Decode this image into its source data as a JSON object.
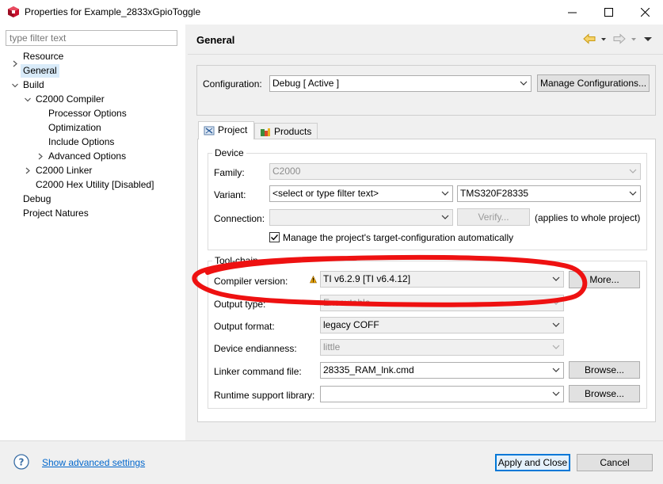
{
  "window": {
    "title": "Properties for Example_2833xGpioToggle"
  },
  "left": {
    "filter_placeholder": "type filter text",
    "tree": {
      "resource": "Resource",
      "general": "General",
      "build": "Build",
      "c2000_compiler": "C2000 Compiler",
      "processor_options": "Processor Options",
      "optimization": "Optimization",
      "include_options": "Include Options",
      "advanced_options": "Advanced Options",
      "c2000_linker": "C2000 Linker",
      "c2000_hex_utility": "C2000 Hex Utility  [Disabled]",
      "debug": "Debug",
      "project_natures": "Project Natures"
    }
  },
  "page": {
    "title": "General",
    "configuration_label": "Configuration:",
    "configuration_value": "Debug  [ Active ]",
    "manage_configurations": "Manage Configurations...",
    "tabs": {
      "project": "Project",
      "products": "Products"
    },
    "device": {
      "group_title": "Device",
      "family_label": "Family:",
      "family_value": "C2000",
      "variant_label": "Variant:",
      "variant_filter": "<select or type filter text>",
      "variant_value": "TMS320F28335",
      "connection_label": "Connection:",
      "connection_value": "",
      "verify_button": "Verify...",
      "applies_note": "(applies to whole project)",
      "manage_target_label": "Manage the project's target-configuration automatically",
      "manage_target_checked": true
    },
    "toolchain": {
      "group_title": "Tool-chain",
      "compiler_version_label": "Compiler version:",
      "compiler_version_value": "TI v6.2.9  [TI v6.4.12]",
      "more_button": "More...",
      "output_type_label": "Output type:",
      "output_type_value": "Executable",
      "output_format_label": "Output format:",
      "output_format_value": "legacy COFF",
      "endianness_label": "Device endianness:",
      "endianness_value": "little",
      "linker_cmd_label": "Linker command file:",
      "linker_cmd_value": "28335_RAM_lnk.cmd",
      "browse_button": "Browse...",
      "runtime_lib_label": "Runtime support library:",
      "runtime_lib_value": ""
    }
  },
  "footer": {
    "show_advanced": "Show advanced settings",
    "apply_close": "Apply and Close",
    "cancel": "Cancel"
  },
  "colors": {
    "annotation_red": "#ee1111",
    "selection": "#d9ebf9",
    "link": "#0066cc",
    "primary_border": "#0078d7",
    "warning_icon": "#e8a200"
  },
  "icons": {
    "app": "ccs-cube-icon",
    "help": "question-circle-icon",
    "back": "back-arrow-icon",
    "forward": "forward-arrow-icon",
    "view_menu": "view-menu-icon",
    "warning": "warning-icon",
    "project_tab": "project-icon",
    "products_tab": "products-icon"
  }
}
